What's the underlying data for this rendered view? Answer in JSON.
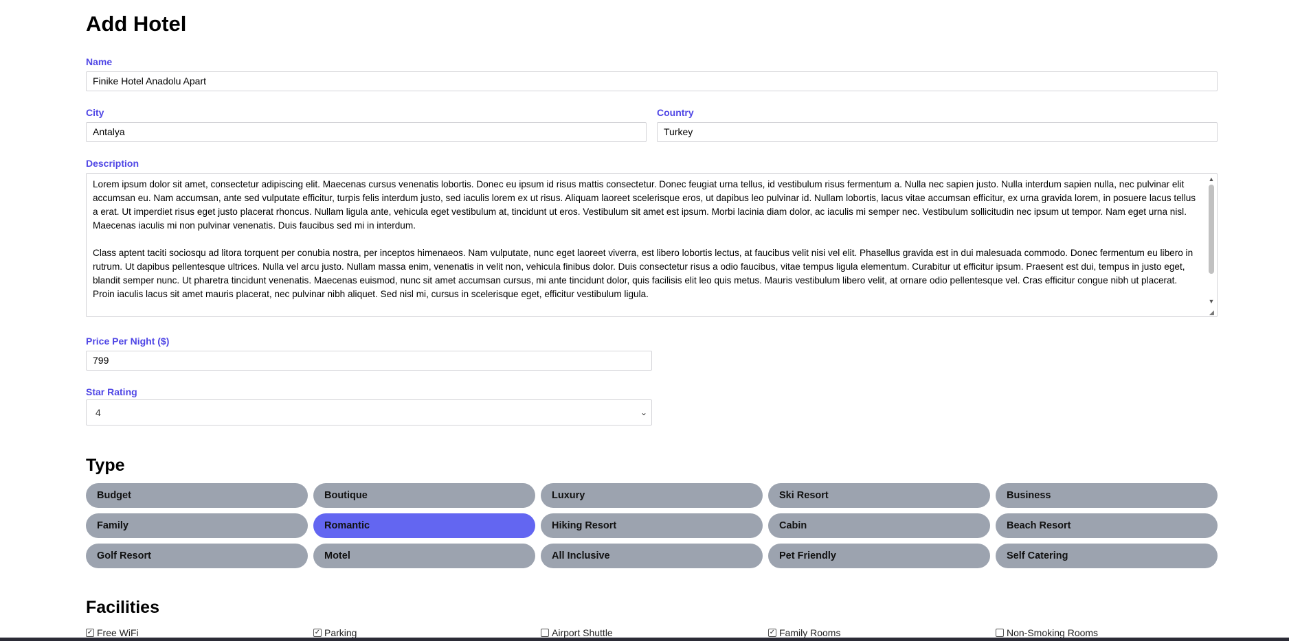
{
  "form": {
    "title": "Add Hotel",
    "name_label": "Name",
    "name_value": "Finike Hotel Anadolu Apart",
    "city_label": "City",
    "city_value": "Antalya",
    "country_label": "Country",
    "country_value": "Turkey",
    "description_label": "Description",
    "description_p1": "Lorem ipsum dolor sit amet, consectetur adipiscing elit. Maecenas cursus venenatis lobortis. Donec eu ipsum id risus mattis consectetur. Donec feugiat urna tellus, id vestibulum risus fermentum a. Nulla nec sapien justo. Nulla interdum sapien nulla, nec pulvinar elit accumsan eu. Nam accumsan, ante sed vulputate efficitur, turpis felis interdum justo, sed iaculis lorem ex ut risus. Aliquam laoreet scelerisque eros, ut dapibus leo pulvinar id. Nullam lobortis, lacus vitae accumsan efficitur, ex urna gravida lorem, in posuere lacus tellus a erat. Ut imperdiet risus eget justo placerat rhoncus. Nullam ligula ante, vehicula eget vestibulum at, tincidunt ut eros. Vestibulum sit amet est ipsum. Morbi lacinia diam dolor, ac iaculis mi semper nec. Vestibulum sollicitudin nec ipsum ut tempor. Nam eget urna nisl. Maecenas iaculis mi non pulvinar venenatis. Duis faucibus sed mi in interdum.",
    "description_p2": "Class aptent taciti sociosqu ad litora torquent per conubia nostra, per inceptos himenaeos. Nam vulputate, nunc eget laoreet viverra, est libero lobortis lectus, at faucibus velit nisi vel elit. Phasellus gravida est in dui malesuada commodo. Donec fermentum eu libero in rutrum. Ut dapibus pellentesque ultrices. Nulla vel arcu justo. Nullam massa enim, venenatis in velit non, vehicula finibus dolor. Duis consectetur risus a odio faucibus, vitae tempus ligula elementum. Curabitur ut efficitur ipsum. Praesent est dui, tempus in justo eget, blandit semper nunc. Ut pharetra tincidunt venenatis. Maecenas euismod, nunc sit amet accumsan cursus, mi ante tincidunt dolor, quis facilisis elit leo quis metus. Mauris vestibulum libero velit, at ornare odio pellentesque vel. Cras efficitur congue nibh ut placerat. Proin iaculis lacus sit amet mauris placerat, nec pulvinar nibh aliquet. Sed nisl mi, cursus in scelerisque eget, efficitur vestibulum ligula.",
    "price_label": "Price Per Night ($)",
    "price_value": "799",
    "star_label": "Star Rating",
    "star_value": "4"
  },
  "type_section": {
    "title": "Type",
    "items": [
      {
        "label": "Budget",
        "selected": false
      },
      {
        "label": "Boutique",
        "selected": false
      },
      {
        "label": "Luxury",
        "selected": false
      },
      {
        "label": "Ski Resort",
        "selected": false
      },
      {
        "label": "Business",
        "selected": false
      },
      {
        "label": "Family",
        "selected": false
      },
      {
        "label": "Romantic",
        "selected": true
      },
      {
        "label": "Hiking Resort",
        "selected": false
      },
      {
        "label": "Cabin",
        "selected": false
      },
      {
        "label": "Beach Resort",
        "selected": false
      },
      {
        "label": "Golf Resort",
        "selected": false
      },
      {
        "label": "Motel",
        "selected": false
      },
      {
        "label": "All Inclusive",
        "selected": false
      },
      {
        "label": "Pet Friendly",
        "selected": false
      },
      {
        "label": "Self Catering",
        "selected": false
      }
    ]
  },
  "facilities_section": {
    "title": "Facilities",
    "items": [
      {
        "label": "Free WiFi",
        "checked": true
      },
      {
        "label": "Parking",
        "checked": true
      },
      {
        "label": "Airport Shuttle",
        "checked": false
      },
      {
        "label": "Family Rooms",
        "checked": true
      },
      {
        "label": "Non-Smoking Rooms",
        "checked": false
      }
    ]
  },
  "colors": {
    "label": "#4f46e5",
    "type_default": "#9ca3af",
    "type_selected": "#6366f1"
  }
}
